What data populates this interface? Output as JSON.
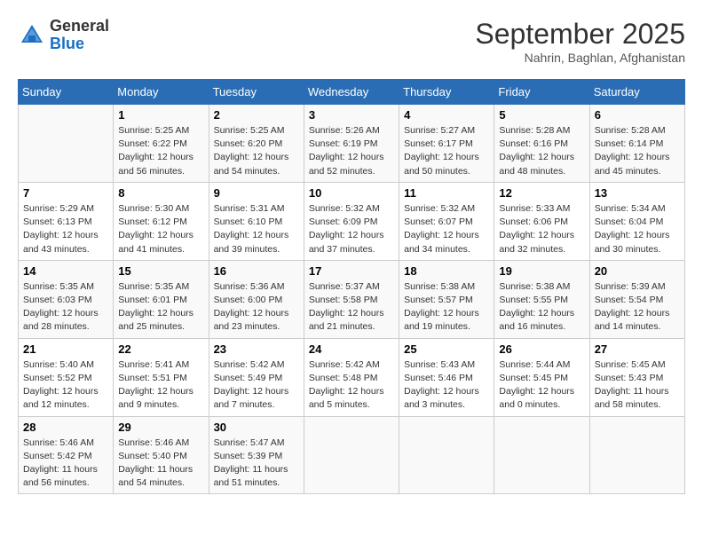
{
  "header": {
    "logo_general": "General",
    "logo_blue": "Blue",
    "month_title": "September 2025",
    "subtitle": "Nahrin, Baghlan, Afghanistan"
  },
  "days_of_week": [
    "Sunday",
    "Monday",
    "Tuesday",
    "Wednesday",
    "Thursday",
    "Friday",
    "Saturday"
  ],
  "weeks": [
    [
      {
        "day": "",
        "info": ""
      },
      {
        "day": "1",
        "info": "Sunrise: 5:25 AM\nSunset: 6:22 PM\nDaylight: 12 hours\nand 56 minutes."
      },
      {
        "day": "2",
        "info": "Sunrise: 5:25 AM\nSunset: 6:20 PM\nDaylight: 12 hours\nand 54 minutes."
      },
      {
        "day": "3",
        "info": "Sunrise: 5:26 AM\nSunset: 6:19 PM\nDaylight: 12 hours\nand 52 minutes."
      },
      {
        "day": "4",
        "info": "Sunrise: 5:27 AM\nSunset: 6:17 PM\nDaylight: 12 hours\nand 50 minutes."
      },
      {
        "day": "5",
        "info": "Sunrise: 5:28 AM\nSunset: 6:16 PM\nDaylight: 12 hours\nand 48 minutes."
      },
      {
        "day": "6",
        "info": "Sunrise: 5:28 AM\nSunset: 6:14 PM\nDaylight: 12 hours\nand 45 minutes."
      }
    ],
    [
      {
        "day": "7",
        "info": "Sunrise: 5:29 AM\nSunset: 6:13 PM\nDaylight: 12 hours\nand 43 minutes."
      },
      {
        "day": "8",
        "info": "Sunrise: 5:30 AM\nSunset: 6:12 PM\nDaylight: 12 hours\nand 41 minutes."
      },
      {
        "day": "9",
        "info": "Sunrise: 5:31 AM\nSunset: 6:10 PM\nDaylight: 12 hours\nand 39 minutes."
      },
      {
        "day": "10",
        "info": "Sunrise: 5:32 AM\nSunset: 6:09 PM\nDaylight: 12 hours\nand 37 minutes."
      },
      {
        "day": "11",
        "info": "Sunrise: 5:32 AM\nSunset: 6:07 PM\nDaylight: 12 hours\nand 34 minutes."
      },
      {
        "day": "12",
        "info": "Sunrise: 5:33 AM\nSunset: 6:06 PM\nDaylight: 12 hours\nand 32 minutes."
      },
      {
        "day": "13",
        "info": "Sunrise: 5:34 AM\nSunset: 6:04 PM\nDaylight: 12 hours\nand 30 minutes."
      }
    ],
    [
      {
        "day": "14",
        "info": "Sunrise: 5:35 AM\nSunset: 6:03 PM\nDaylight: 12 hours\nand 28 minutes."
      },
      {
        "day": "15",
        "info": "Sunrise: 5:35 AM\nSunset: 6:01 PM\nDaylight: 12 hours\nand 25 minutes."
      },
      {
        "day": "16",
        "info": "Sunrise: 5:36 AM\nSunset: 6:00 PM\nDaylight: 12 hours\nand 23 minutes."
      },
      {
        "day": "17",
        "info": "Sunrise: 5:37 AM\nSunset: 5:58 PM\nDaylight: 12 hours\nand 21 minutes."
      },
      {
        "day": "18",
        "info": "Sunrise: 5:38 AM\nSunset: 5:57 PM\nDaylight: 12 hours\nand 19 minutes."
      },
      {
        "day": "19",
        "info": "Sunrise: 5:38 AM\nSunset: 5:55 PM\nDaylight: 12 hours\nand 16 minutes."
      },
      {
        "day": "20",
        "info": "Sunrise: 5:39 AM\nSunset: 5:54 PM\nDaylight: 12 hours\nand 14 minutes."
      }
    ],
    [
      {
        "day": "21",
        "info": "Sunrise: 5:40 AM\nSunset: 5:52 PM\nDaylight: 12 hours\nand 12 minutes."
      },
      {
        "day": "22",
        "info": "Sunrise: 5:41 AM\nSunset: 5:51 PM\nDaylight: 12 hours\nand 9 minutes."
      },
      {
        "day": "23",
        "info": "Sunrise: 5:42 AM\nSunset: 5:49 PM\nDaylight: 12 hours\nand 7 minutes."
      },
      {
        "day": "24",
        "info": "Sunrise: 5:42 AM\nSunset: 5:48 PM\nDaylight: 12 hours\nand 5 minutes."
      },
      {
        "day": "25",
        "info": "Sunrise: 5:43 AM\nSunset: 5:46 PM\nDaylight: 12 hours\nand 3 minutes."
      },
      {
        "day": "26",
        "info": "Sunrise: 5:44 AM\nSunset: 5:45 PM\nDaylight: 12 hours\nand 0 minutes."
      },
      {
        "day": "27",
        "info": "Sunrise: 5:45 AM\nSunset: 5:43 PM\nDaylight: 11 hours\nand 58 minutes."
      }
    ],
    [
      {
        "day": "28",
        "info": "Sunrise: 5:46 AM\nSunset: 5:42 PM\nDaylight: 11 hours\nand 56 minutes."
      },
      {
        "day": "29",
        "info": "Sunrise: 5:46 AM\nSunset: 5:40 PM\nDaylight: 11 hours\nand 54 minutes."
      },
      {
        "day": "30",
        "info": "Sunrise: 5:47 AM\nSunset: 5:39 PM\nDaylight: 11 hours\nand 51 minutes."
      },
      {
        "day": "",
        "info": ""
      },
      {
        "day": "",
        "info": ""
      },
      {
        "day": "",
        "info": ""
      },
      {
        "day": "",
        "info": ""
      }
    ]
  ]
}
